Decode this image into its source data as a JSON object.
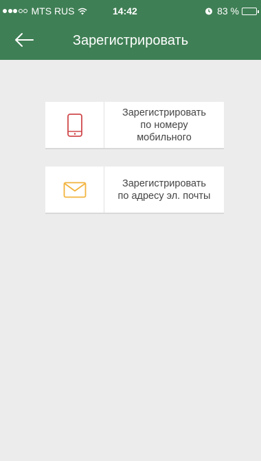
{
  "status": {
    "carrier": "MTS RUS",
    "time": "14:42",
    "battery": "83 %",
    "battery_level": 0.83
  },
  "header": {
    "title": "Зарегистрировать"
  },
  "options": [
    {
      "label_lines": [
        "Зарегистрировать",
        "по номеру",
        "мобильного"
      ],
      "icon": "mobile-phone-icon"
    },
    {
      "label_lines": [
        "Зарегистрировать",
        "по адресу эл. почты"
      ],
      "icon": "envelope-icon"
    }
  ],
  "colors": {
    "header": "#3f7f55",
    "background": "#ececec",
    "phone_icon": "#d0494c",
    "mail_icon": "#f2b33d"
  }
}
